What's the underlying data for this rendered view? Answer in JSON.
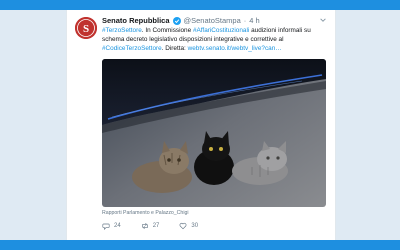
{
  "tweet": {
    "author_name": "Senato Repubblica",
    "handle": "@SenatoStampa",
    "separator": "·",
    "time": "4 h",
    "text": {
      "hashtag_1": "#TerzoSettore",
      "part_1": ". In Commissione ",
      "hashtag_2": "#AffariCostituzionali",
      "part_2": " audizioni informali su schema decreto legislativo disposizioni integrative e correttive al ",
      "hashtag_3": "#CodiceTerzoSettore",
      "part_3": ". Diretta: ",
      "link": "webtv.senato.it/webtv_live?can…"
    },
    "photo_caption": "Rapporti Parlamento e Palazzo_Chigi",
    "actions": {
      "replies": "24",
      "retweets": "27",
      "likes": "30"
    }
  },
  "colors": {
    "accent": "#1e8fe0",
    "link": "#1b95e0",
    "avatar_red": "#c0322e",
    "background": "#dfeaf3"
  },
  "icons": [
    "senate-logo-icon",
    "verified-icon",
    "chevron-down-icon",
    "reply-icon",
    "retweet-icon",
    "like-icon"
  ]
}
